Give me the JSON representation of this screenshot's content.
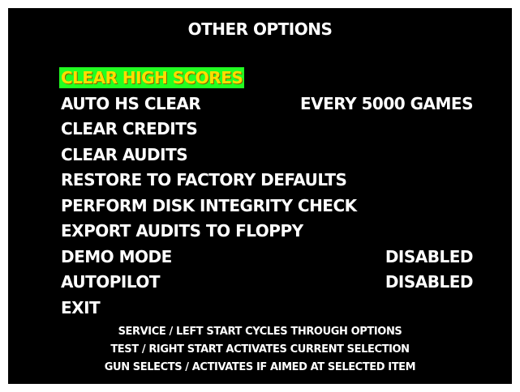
{
  "screen": {
    "title": "OTHER OPTIONS",
    "colors": {
      "background": "#000000",
      "text": "#ffffff",
      "selected_highlight": "#22ff22",
      "selected_text": "#ffdd00"
    }
  },
  "menu": {
    "items": [
      {
        "label": "CLEAR HIGH SCORES",
        "value": "",
        "selected": true
      },
      {
        "label": "AUTO HS CLEAR",
        "value": "EVERY 5000 GAMES",
        "selected": false
      },
      {
        "label": "CLEAR CREDITS",
        "value": "",
        "selected": false
      },
      {
        "label": "CLEAR AUDITS",
        "value": "",
        "selected": false
      },
      {
        "label": "RESTORE TO FACTORY DEFAULTS",
        "value": "",
        "selected": false
      },
      {
        "label": "PERFORM DISK INTEGRITY CHECK",
        "value": "",
        "selected": false
      },
      {
        "label": "EXPORT AUDITS TO FLOPPY",
        "value": "",
        "selected": false
      },
      {
        "label": "DEMO MODE",
        "value": "DISABLED",
        "selected": false
      },
      {
        "label": "AUTOPILOT",
        "value": "DISABLED",
        "selected": false
      },
      {
        "label": "EXIT",
        "value": "",
        "selected": false
      }
    ]
  },
  "footer": {
    "lines": [
      "SERVICE / LEFT START CYCLES THROUGH OPTIONS",
      "TEST / RIGHT START ACTIVATES CURRENT SELECTION",
      "GUN SELECTS / ACTIVATES IF AIMED AT SELECTED ITEM"
    ]
  }
}
